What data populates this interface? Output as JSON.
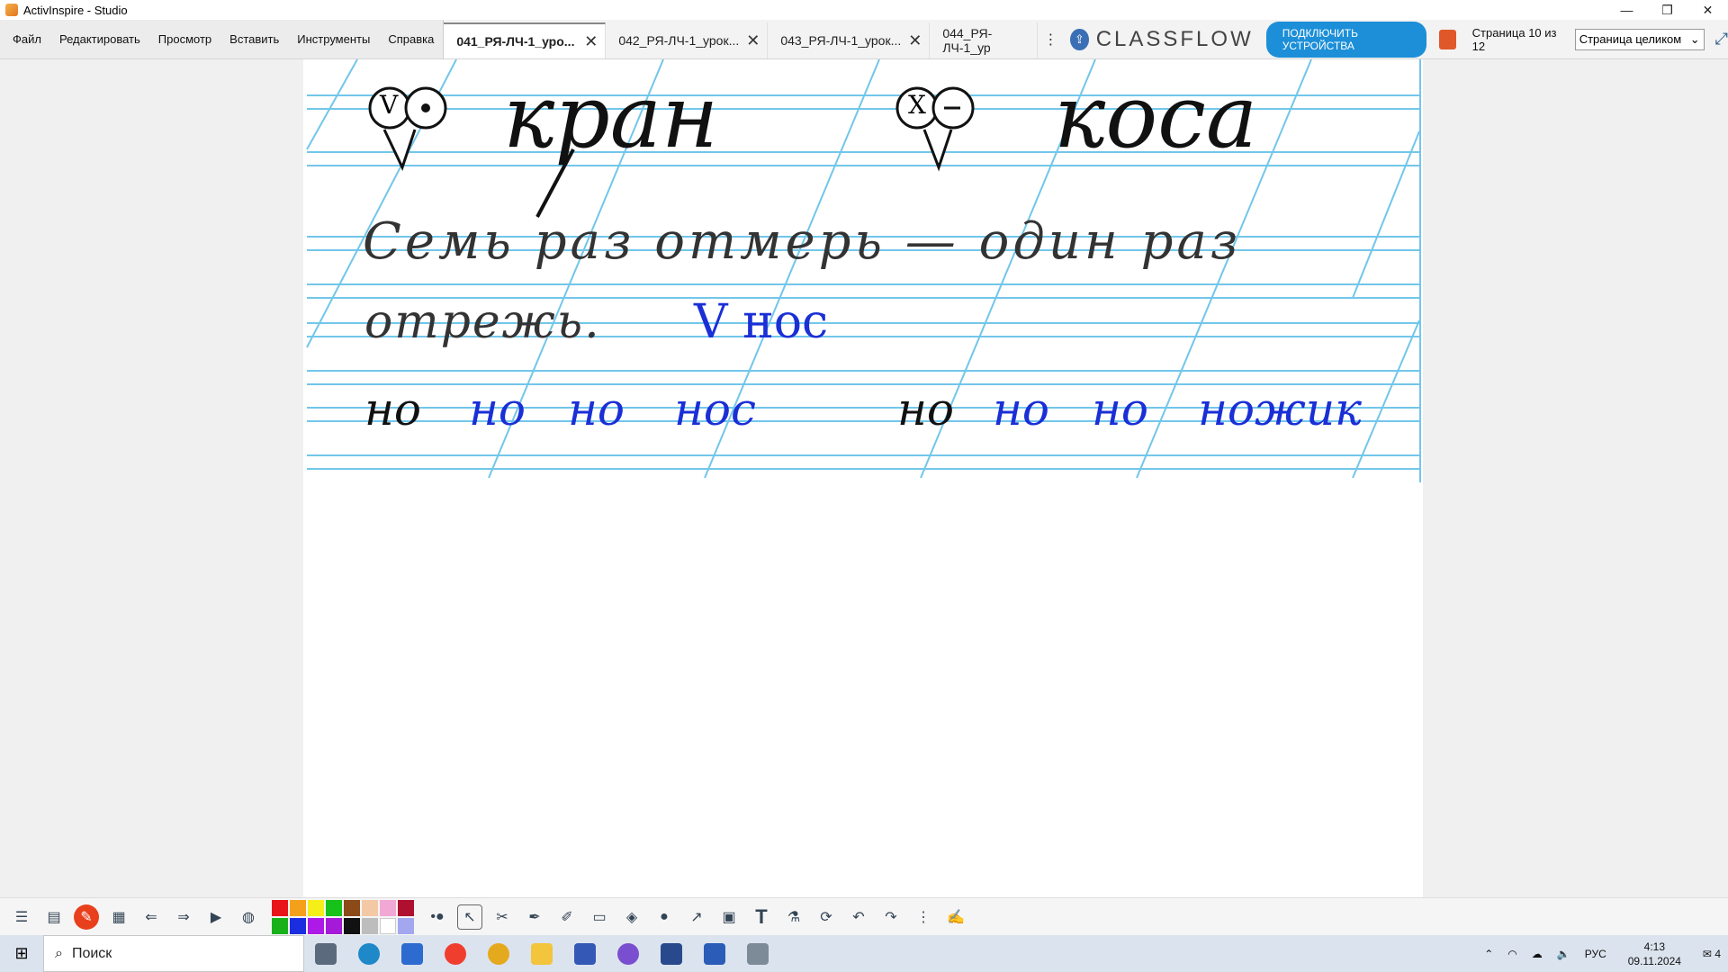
{
  "window": {
    "title": "ActivInspire - Studio"
  },
  "menu": {
    "items": [
      "Файл",
      "Редактировать",
      "Просмотр",
      "Вставить",
      "Инструменты",
      "Справка"
    ]
  },
  "tabs": [
    {
      "label": "041_РЯ-ЛЧ-1_уро...",
      "active": true
    },
    {
      "label": "042_РЯ-ЛЧ-1_урок...",
      "active": false
    },
    {
      "label": "043_РЯ-ЛЧ-1_урок...",
      "active": false
    },
    {
      "label": "044_РЯ-ЛЧ-1_ур",
      "active": false
    }
  ],
  "classflow": {
    "brand": "CLASSFLOW",
    "connect_label": "ПОДКЛЮЧИТЬ УСТРОЙСТВА"
  },
  "page_info": "Страница 10 из 12",
  "zoom": {
    "selected": "Страница целиком"
  },
  "flipchart": {
    "word_left": "кран",
    "word_right": "коса",
    "proverb_line1": "Семь раз отмерь — один раз",
    "proverb_line2": "отрежь.",
    "blue_note": "V нос",
    "row3": [
      "но",
      "но",
      "но",
      "нос",
      "но",
      "но",
      "но",
      "ножик"
    ],
    "sound_left_symbol": "V",
    "sound_right_symbol": "X"
  },
  "colors": {
    "ruling": "#72c6ea",
    "ink_blue": "#1a2fd6",
    "ink_black": "#111111",
    "palette": [
      "#e8141a",
      "#f5a01a",
      "#f5ee18",
      "#16c21a",
      "#8b4a18",
      "#f3c9a5",
      "#f1a8d5",
      "#b01030",
      "#18b11a",
      "#1a2ee0",
      "#ad1ae8",
      "#a41ad8",
      "#111111",
      "#bdbdbd",
      "#ffffff",
      "#a3a7f0"
    ]
  },
  "taskbar": {
    "search_placeholder": "Поиск",
    "lang": "РУС",
    "time": "4:13",
    "date": "09.11.2024",
    "notifications": "4"
  }
}
